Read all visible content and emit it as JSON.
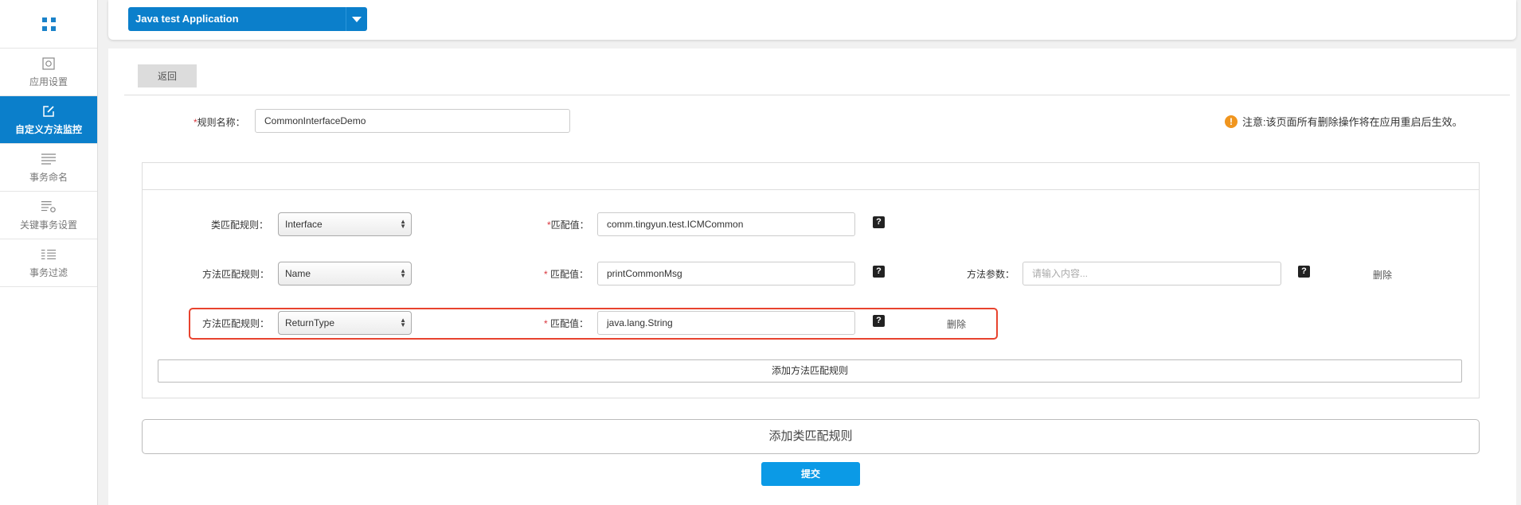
{
  "app_selector": {
    "value": "Java test Application"
  },
  "sidebar": {
    "items": [
      {
        "label": "应用设置"
      },
      {
        "label": "自定义方法监控"
      },
      {
        "label": "事务命名"
      },
      {
        "label": "关键事务设置"
      },
      {
        "label": "事务过滤"
      }
    ]
  },
  "back_label": "返回",
  "rule_name": {
    "label": "规则名称：",
    "value": "CommonInterfaceDemo"
  },
  "notice": "注意:该页面所有删除操作将在应用重启后生效。",
  "class_rule": {
    "label": "类匹配规则：",
    "select": "Interface",
    "match_label": "匹配值：",
    "match_value": "comm.tingyun.test.ICMCommon",
    "help": "?"
  },
  "method_rules": [
    {
      "label": "方法匹配规则：",
      "select": "Name",
      "match_label": " 匹配值：",
      "match_value": "printCommonMsg",
      "help": "?",
      "params_label": "方法参数：",
      "params_placeholder": "请输入内容...",
      "params_help": "?",
      "delete": "删除"
    },
    {
      "label": "方法匹配规则：",
      "select": "ReturnType",
      "match_label": " 匹配值：",
      "match_value": "java.lang.String",
      "help": "?",
      "delete": "删除"
    }
  ],
  "add_method_label": "添加方法匹配规则",
  "add_class_label": "添加类匹配规则",
  "submit_label": "提交",
  "colors": {
    "primary": "#0b7fcb",
    "submit": "#0b9ae6",
    "highlight": "#e8432e",
    "warning": "#f0951e"
  }
}
